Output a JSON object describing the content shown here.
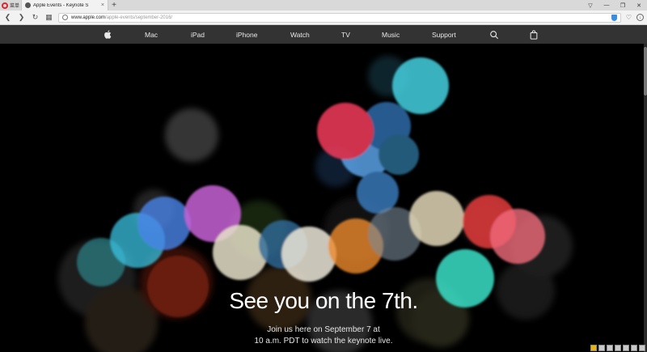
{
  "browser": {
    "menu_label": "菜单",
    "tab_title": "Apple Events - Keynote S",
    "tab_close": "×",
    "new_tab": "+",
    "url_domain": "www.apple.com",
    "url_path": "/apple-events/september-2016/",
    "window_controls": [
      "▽",
      "—",
      "❐",
      "✕"
    ]
  },
  "globalnav": {
    "items": [
      "Mac",
      "iPad",
      "iPhone",
      "Watch",
      "TV",
      "Music",
      "Support"
    ]
  },
  "hero": {
    "headline": "See you on the 7th.",
    "line1": "Join us here on September 7 at",
    "line2": "10 a.m. PDT to watch the keynote live."
  },
  "colors": {
    "nav_bg": "#333333",
    "hero_bg": "#000000"
  }
}
